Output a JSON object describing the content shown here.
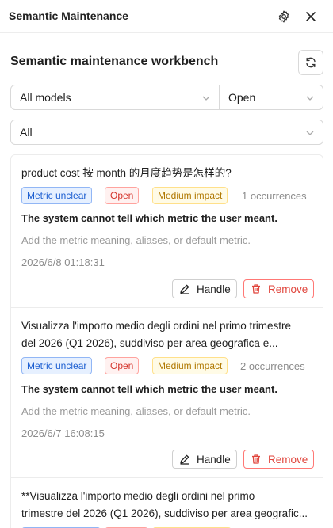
{
  "panel": {
    "title": "Semantic Maintenance"
  },
  "workbench": {
    "title": "Semantic maintenance workbench"
  },
  "filters": {
    "model": "All models",
    "status": "Open",
    "category": "All"
  },
  "items": [
    {
      "question_line1": "product cost 按 month 的月度趋势是怎样的?",
      "tags": {
        "type": "Metric unclear",
        "status": "Open",
        "impact": "Medium impact"
      },
      "occurrences": "1 occurrences",
      "summary": "The system cannot tell which metric the user meant.",
      "hint": "Add the metric meaning, aliases, or default metric.",
      "timestamp": "2026/6/8 01:18:31",
      "handle_label": "Handle",
      "remove_label": "Remove"
    },
    {
      "question_line1": "Visualizza l'importo medio degli ordini nel primo trimestre",
      "question_line2": "del 2026 (Q1 2026), suddiviso per area geografica e...",
      "tags": {
        "type": "Metric unclear",
        "status": "Open",
        "impact": "Medium impact"
      },
      "occurrences": "2 occurrences",
      "summary": "The system cannot tell which metric the user meant.",
      "hint": "Add the metric meaning, aliases, or default metric.",
      "timestamp": "2026/6/7 16:08:15",
      "handle_label": "Handle",
      "remove_label": "Remove"
    },
    {
      "question_line1": "**Visualizza l'importo medio degli ordini nel primo",
      "question_line2": "trimestre del 2026 (Q1 2026), suddiviso per area geografic..."
    }
  ]
}
